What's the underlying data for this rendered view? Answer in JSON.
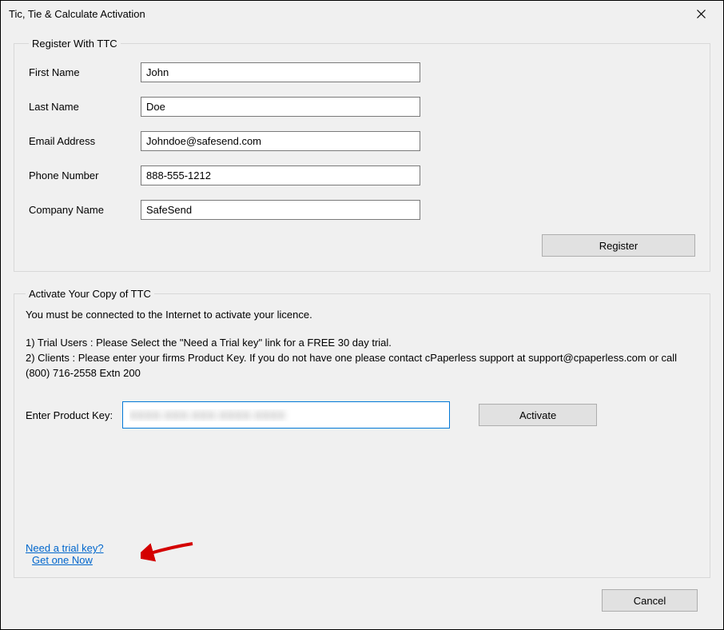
{
  "window": {
    "title": "Tic, Tie & Calculate Activation"
  },
  "register": {
    "legend": "Register With TTC",
    "firstNameLabel": "First Name",
    "firstNameValue": "John",
    "lastNameLabel": "Last Name",
    "lastNameValue": "Doe",
    "emailLabel": "Email Address",
    "emailValue": "Johndoe@safesend.com",
    "phoneLabel": "Phone Number",
    "phoneValue": "888-555-1212",
    "companyLabel": "Company Name",
    "companyValue": "SafeSend",
    "registerButton": "Register"
  },
  "activate": {
    "legend": "Activate Your Copy of TTC",
    "intro": "You must be connected to the Internet to activate your licence.",
    "line1": "1) Trial Users : Please Select the \"Need a Trial key\" link for a FREE 30 day trial.",
    "line2": "2) Clients : Please enter your firms Product Key. If you do not have one please contact cPaperless support at support@cpaperless.com or call (800) 716-2558 Extn 200",
    "productKeyLabel": "Enter Product Key:",
    "productKeyValue": "XXXX-XXX-XXX-XXXX-XXXX",
    "activateButton": "Activate",
    "trialLinkLine1": "Need a trial key?",
    "trialLinkLine2": "Get one Now"
  },
  "footer": {
    "cancelButton": "Cancel"
  }
}
